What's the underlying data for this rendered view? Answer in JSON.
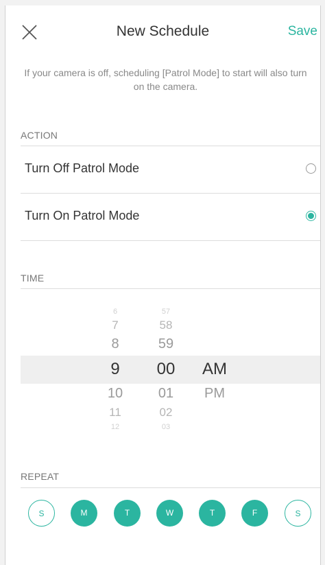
{
  "header": {
    "title": "New Schedule",
    "save_label": "Save"
  },
  "notice": "If your camera is off, scheduling [Patrol Mode] to start will also turn on the camera.",
  "action": {
    "section_label": "ACTION",
    "options": [
      {
        "label": "Turn Off Patrol Mode",
        "selected": false
      },
      {
        "label": "Turn On Patrol Mode",
        "selected": true
      }
    ]
  },
  "time": {
    "section_label": "TIME",
    "hours": [
      "6",
      "7",
      "8",
      "9",
      "10",
      "11",
      "12"
    ],
    "minutes": [
      "57",
      "58",
      "59",
      "00",
      "01",
      "02",
      "03"
    ],
    "periods": [
      "AM",
      "PM"
    ],
    "selected": {
      "hour": "9",
      "minute": "00",
      "period": "AM"
    }
  },
  "repeat": {
    "section_label": "REPEAT",
    "days": [
      {
        "label": "S",
        "active": false
      },
      {
        "label": "M",
        "active": true
      },
      {
        "label": "T",
        "active": true
      },
      {
        "label": "W",
        "active": true
      },
      {
        "label": "T",
        "active": true
      },
      {
        "label": "F",
        "active": true
      },
      {
        "label": "S",
        "active": false
      }
    ]
  },
  "colors": {
    "accent": "#2bb5a0",
    "text": "#333333",
    "muted": "#888888"
  }
}
